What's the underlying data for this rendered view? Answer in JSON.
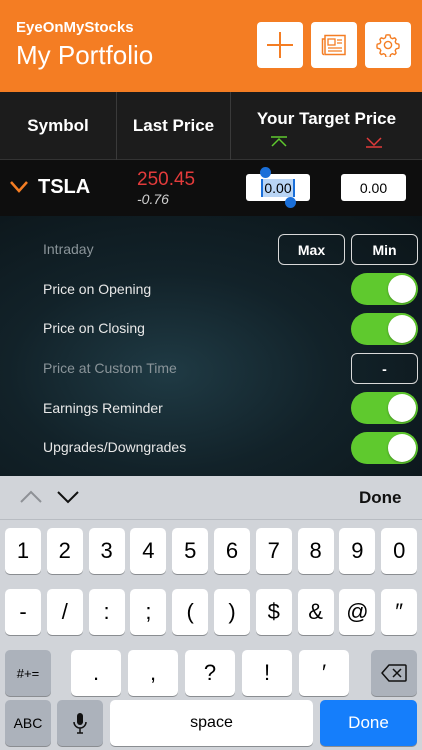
{
  "header": {
    "app_name": "EyeOnMyStocks",
    "title": "My Portfolio"
  },
  "header_buttons": [
    {
      "name": "add-icon"
    },
    {
      "name": "news-icon"
    },
    {
      "name": "gear-icon"
    }
  ],
  "columns": {
    "symbol": "Symbol",
    "last_price": "Last Price",
    "target": "Your Target Price"
  },
  "arrow_colors": {
    "up": "#5fc92e",
    "down": "#e23b3b"
  },
  "stock": {
    "symbol": "TSLA",
    "price": "250.45",
    "change": "-0.76",
    "low_target": "0.00",
    "high_target": "0.00",
    "price_color": "#e23b3b"
  },
  "alerts": {
    "intraday": "Intraday",
    "max": "Max",
    "min": "Min",
    "opening": "Price on Opening",
    "closing": "Price on Closing",
    "custom_time": "Price at Custom Time",
    "custom_time_value": "-",
    "earnings": "Earnings Reminder",
    "upgrades": "Upgrades/Downgrades"
  },
  "toggles": {
    "opening": true,
    "closing": true,
    "earnings": true,
    "upgrades": true
  },
  "keyboard": {
    "done": "Done",
    "row1": [
      "1",
      "2",
      "3",
      "4",
      "5",
      "6",
      "7",
      "8",
      "9",
      "0"
    ],
    "row2": [
      "-",
      "/",
      ":",
      ";",
      "(",
      ")",
      "$",
      "&",
      "@",
      "″"
    ],
    "row3": [
      ".",
      ",",
      "?",
      "!",
      "′"
    ],
    "symbols": "#+=",
    "abc": "ABC",
    "space": "space",
    "return": "Done"
  }
}
